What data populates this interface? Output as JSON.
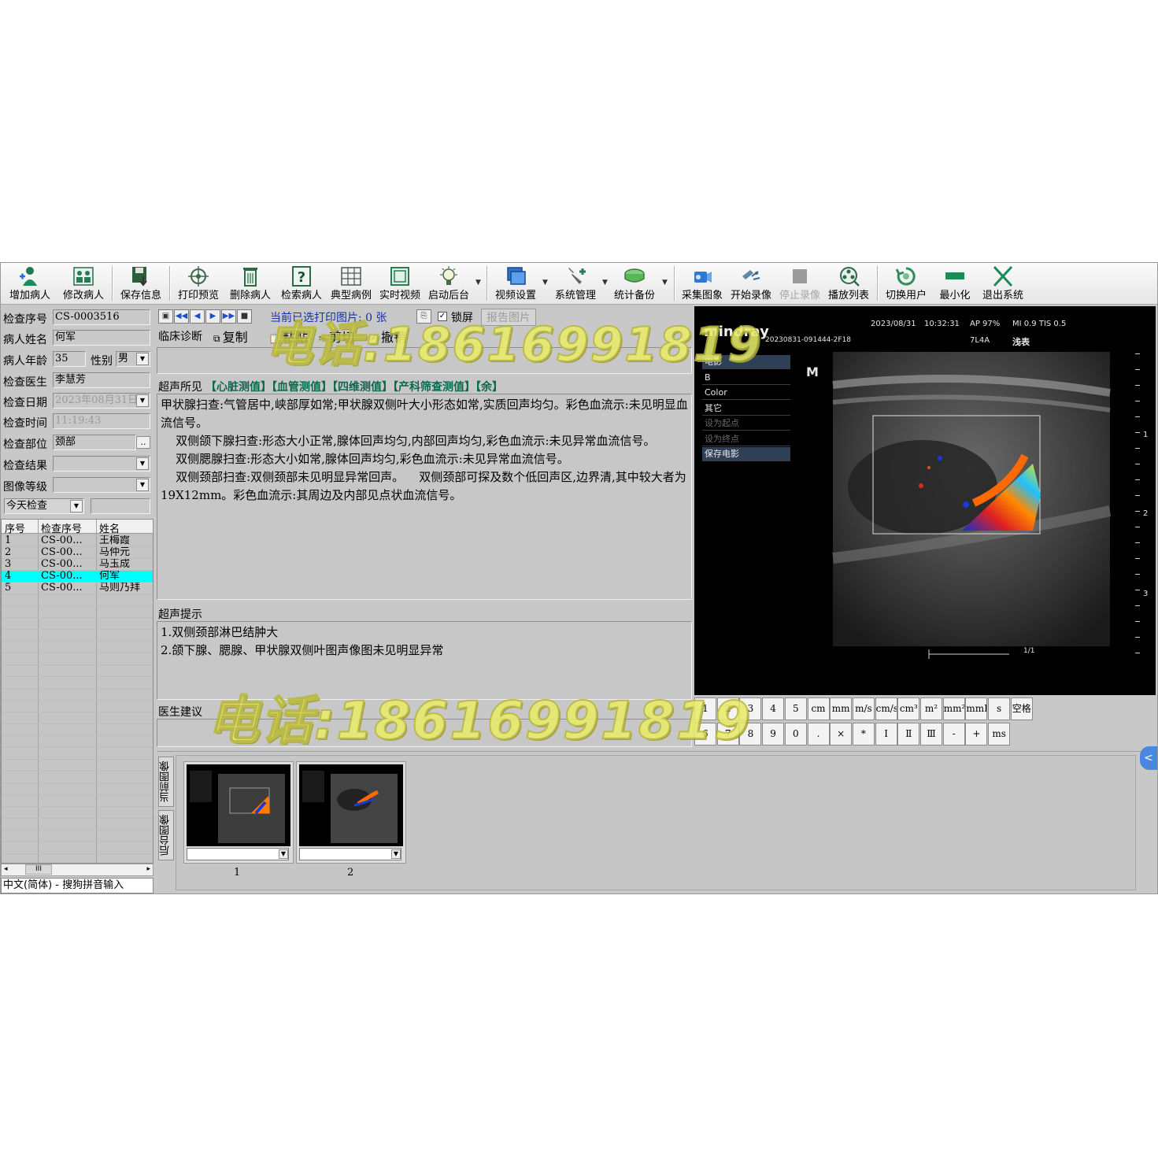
{
  "toolbar": {
    "add_patient": "增加病人",
    "edit_patient": "修改病人",
    "save_info": "保存信息",
    "print_preview": "打印预览",
    "delete_patient": "删除病人",
    "search_patient": "检索病人",
    "typical_cases": "典型病例",
    "live_video": "实时视频",
    "start_backend": "启动后台",
    "video_settings": "视频设置",
    "system_management": "系统管理",
    "stats_backup": "统计备份",
    "capture_image": "采集图象",
    "start_recording": "开始录像",
    "stop_recording": "停止录像",
    "playlist": "播放列表",
    "switch_user": "切换用户",
    "minimize": "最小化",
    "exit_system": "退出系统"
  },
  "patient": {
    "exam_no_label": "检查序号",
    "exam_no": "CS-0003516",
    "name_label": "病人姓名",
    "name": "何军",
    "age_label": "病人年龄",
    "age": "35",
    "sex_label": "性别",
    "sex": "男",
    "doctor_label": "检查医生",
    "doctor": "李慧芳",
    "date_label": "检查日期",
    "date": "2023年08月31日",
    "time_label": "检查时间",
    "time": "11:19:43",
    "site_label": "检查部位",
    "site": "颈部",
    "site_btn": "..",
    "result_label": "检查结果",
    "result": "",
    "grade_label": "图像等级",
    "grade": "",
    "filter": "今天检查"
  },
  "patient_list": {
    "headers": [
      "序号",
      "检查序号",
      "姓名"
    ],
    "rows": [
      {
        "no": "1",
        "exam": "CS-00...",
        "name": "王梅霞"
      },
      {
        "no": "2",
        "exam": "CS-00...",
        "name": "马仲元"
      },
      {
        "no": "3",
        "exam": "CS-00...",
        "name": "马玉成"
      },
      {
        "no": "4",
        "exam": "CS-00...",
        "name": "何军"
      },
      {
        "no": "5",
        "exam": "CS-00...",
        "name": "马则乃拜"
      }
    ],
    "selected_index": 3
  },
  "scroll_thumb": "III",
  "ime": "中文(简体) - 搜狗拼音输入",
  "report": {
    "printed_count": "当前已选打印图片: 0 张",
    "lock_label": "锁屏",
    "report_images_btn": "报告图片",
    "clinical_label": "临床诊断",
    "copy": "复制",
    "paste": "粘贴",
    "cut": "剪切",
    "undo": "撤销",
    "findings_label": "超声所见",
    "measure_links": [
      "【心脏测值】",
      "【血管测值】",
      "【四维测值】",
      "【产科筛查测值】",
      "【余】"
    ],
    "findings_text": "甲状腺扫查:气管居中,峡部厚如常;甲状腺双侧叶大小形态如常,实质回声均匀。彩色血流示:未见明显血流信号。\n    双侧颌下腺扫查:形态大小正常,腺体回声均匀,内部回声均匀,彩色血流示:未见异常血流信号。\n    双侧腮腺扫查:形态大小如常,腺体回声均匀,彩色血流示:未见异常血流信号。\n    双侧颈部扫查:双侧颈部未见明显异常回声。    双侧颈部可探及数个低回声区,边界清,其中较大者为19X12mm。彩色血流示:其周边及内部见点状血流信号。",
    "impression_label": "超声提示",
    "impression_text": "1.双侧颈部淋巴结肿大\n2.颌下腺、腮腺、甲状腺双侧叶图声像图未见明显异常",
    "advice_label": "医生建议"
  },
  "ultrasound": {
    "brand": "mindray",
    "date": "2023/08/31",
    "time": "10:32:31",
    "ap": "AP 97%",
    "mi": "MI 0.9 TIS 0.5",
    "file": "20230831-091444-2F18",
    "probe": "7L4A",
    "preset": "浅表",
    "logo_m": "M",
    "menu": [
      "电影",
      "B",
      "Color",
      "其它",
      "设为起点",
      "设为终点",
      "保存电影"
    ],
    "scale_labels": [
      "1",
      "2",
      "3"
    ],
    "page": "1/1"
  },
  "keypad": {
    "row1": [
      "1",
      "2",
      "3",
      "4",
      "5",
      "cm",
      "mm",
      "m/s",
      "cm/s",
      "cm³",
      "m²",
      "mm²",
      "mmHg",
      "s",
      "空格"
    ],
    "row2": [
      "6",
      "7",
      "8",
      "9",
      "0",
      ".",
      "×",
      "*",
      "Ⅰ",
      "Ⅱ",
      "Ⅲ",
      "-",
      "+",
      "ms"
    ]
  },
  "thumbs": {
    "tab_current": "当前图像",
    "tab_backend": "后台图像",
    "numbers": [
      "1",
      "2"
    ],
    "collapse": "<"
  },
  "watermark": "电话:18616991819",
  "colors": {
    "selection": "#00ffff",
    "panel": "#c8c8c8",
    "link": "#0a6a4e",
    "watermark": "#e8ec6a"
  }
}
